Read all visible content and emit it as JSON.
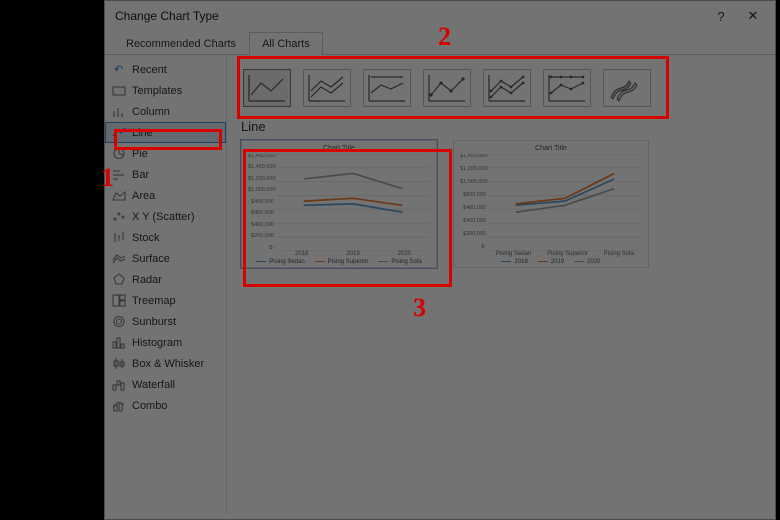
{
  "dialog": {
    "title": "Change Chart Type",
    "help_label": "?",
    "close_label": "✕"
  },
  "tabs": [
    "Recommended Charts",
    "All Charts"
  ],
  "active_tab_index": 1,
  "sidebar": {
    "items": [
      {
        "label": "Recent"
      },
      {
        "label": "Templates"
      },
      {
        "label": "Column"
      },
      {
        "label": "Line"
      },
      {
        "label": "Pie"
      },
      {
        "label": "Bar"
      },
      {
        "label": "Area"
      },
      {
        "label": "X Y (Scatter)"
      },
      {
        "label": "Stock"
      },
      {
        "label": "Surface"
      },
      {
        "label": "Radar"
      },
      {
        "label": "Treemap"
      },
      {
        "label": "Sunburst"
      },
      {
        "label": "Histogram"
      },
      {
        "label": "Box & Whisker"
      },
      {
        "label": "Waterfall"
      },
      {
        "label": "Combo"
      }
    ],
    "selected_index": 3
  },
  "content": {
    "chart_type_name": "Line"
  },
  "chart_data": {
    "type": "line",
    "title": "Chart Title",
    "xlabel": "",
    "ylabel": "",
    "ylim": [
      0,
      1600000
    ],
    "y_ticks": [
      "$1,400,000",
      "$1,400,000",
      "$1,200,000",
      "$1,000,000",
      "$400,000",
      "$400,000",
      "$400,000",
      "$200,000",
      "$-"
    ],
    "categories": [
      "2018",
      "2019",
      "2020"
    ],
    "series": [
      {
        "name": "Pising Sedan",
        "color": "#5b9bd5",
        "values": [
          760000,
          770000,
          640000
        ]
      },
      {
        "name": "Pising Superior",
        "color": "#ed7d31",
        "values": [
          820000,
          860000,
          760000
        ]
      },
      {
        "name": "Pising Sofa",
        "color": "#a5a5a5",
        "values": [
          1180000,
          1280000,
          1020000
        ]
      }
    ],
    "preview2": {
      "title": "Chart Title",
      "y_ticks": [
        "$1,400,000",
        "$1,200,000",
        "$1,000,000",
        "$800,000",
        "$400,000",
        "$400,000",
        "$200,000",
        "$-"
      ],
      "x_labels": [
        "Pising Sedan",
        "Pising Superior",
        "Pising Sofa"
      ],
      "legend": [
        "2018",
        "2019",
        "2020"
      ],
      "series_colors": [
        "#5b9bd5",
        "#ed7d31",
        "#a5a5a5"
      ]
    }
  },
  "annotations": {
    "n1": "1",
    "n2": "2",
    "n3": "3"
  }
}
